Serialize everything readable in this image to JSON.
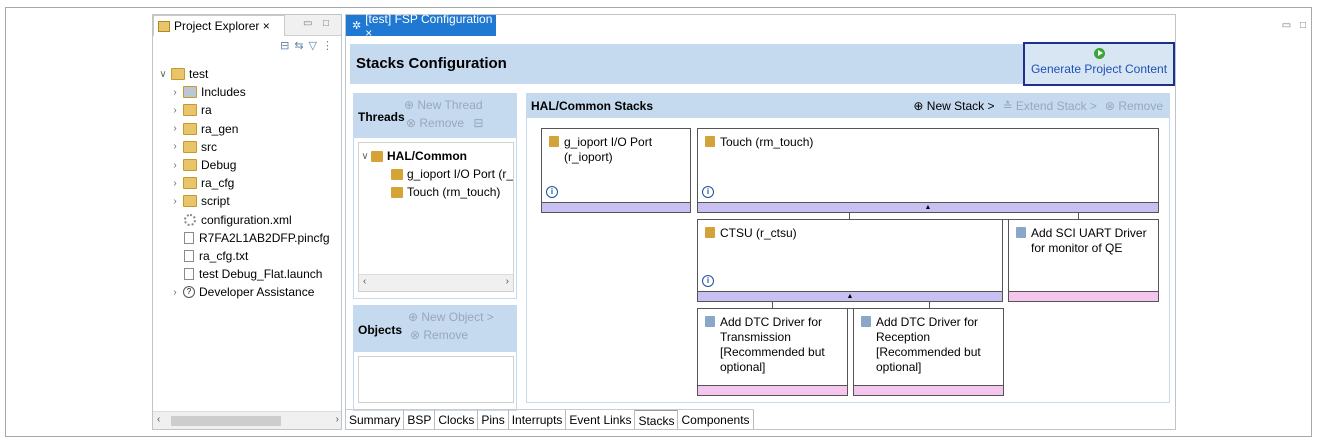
{
  "project_explorer": {
    "tab_label": "Project Explorer ×",
    "tree": [
      {
        "label": "test",
        "indent": 0,
        "chev": "∨",
        "icon": "project"
      },
      {
        "label": "Includes",
        "indent": 1,
        "chev": "›",
        "icon": "includes"
      },
      {
        "label": "ra",
        "indent": 1,
        "chev": "›",
        "icon": "folder"
      },
      {
        "label": "ra_gen",
        "indent": 1,
        "chev": "›",
        "icon": "folder"
      },
      {
        "label": "src",
        "indent": 1,
        "chev": "›",
        "icon": "folder"
      },
      {
        "label": "Debug",
        "indent": 1,
        "chev": "›",
        "icon": "folder"
      },
      {
        "label": "ra_cfg",
        "indent": 1,
        "chev": "›",
        "icon": "folder"
      },
      {
        "label": "script",
        "indent": 1,
        "chev": "›",
        "icon": "folder"
      },
      {
        "label": "configuration.xml",
        "indent": 1,
        "chev": "",
        "icon": "gear"
      },
      {
        "label": "R7FA2L1AB2DFP.pincfg",
        "indent": 1,
        "chev": "",
        "icon": "file"
      },
      {
        "label": "ra_cfg.txt",
        "indent": 1,
        "chev": "",
        "icon": "file"
      },
      {
        "label": "test Debug_Flat.launch",
        "indent": 1,
        "chev": "",
        "icon": "file"
      },
      {
        "label": "Developer Assistance",
        "indent": 1,
        "chev": "›",
        "icon": "help"
      }
    ]
  },
  "editor": {
    "tab_label": "[test] FSP Configuration ×",
    "title": "Stacks Configuration",
    "generate_button": "Generate Project Content",
    "threads": {
      "title": "Threads",
      "new_thread": "New Thread",
      "remove": "Remove",
      "items": [
        {
          "label": "HAL/Common",
          "bold": true
        },
        {
          "label": "g_ioport I/O Port (r_",
          "bold": false
        },
        {
          "label": "Touch (rm_touch)",
          "bold": false
        }
      ]
    },
    "objects": {
      "title": "Objects",
      "new_object": "New Object >",
      "remove": "Remove"
    },
    "stacks": {
      "title": "HAL/Common Stacks",
      "new_stack": "New Stack >",
      "extend_stack": "Extend Stack >",
      "remove": "Remove",
      "modules": {
        "ioport": "g_ioport I/O Port\n(r_ioport)",
        "touch": "Touch (rm_touch)",
        "ctsu": "CTSU (r_ctsu)",
        "sci": "Add SCI UART Driver\nfor monitor of QE",
        "dtc_tx": "Add DTC Driver for\nTransmission\n[Recommended but\noptional]",
        "dtc_rx": "Add DTC Driver for\nReception\n[Recommended but\noptional]"
      }
    },
    "bottom_tabs": [
      "Summary",
      "BSP",
      "Clocks",
      "Pins",
      "Interrupts",
      "Event Links",
      "Stacks",
      "Components"
    ],
    "active_tab": "Stacks"
  }
}
